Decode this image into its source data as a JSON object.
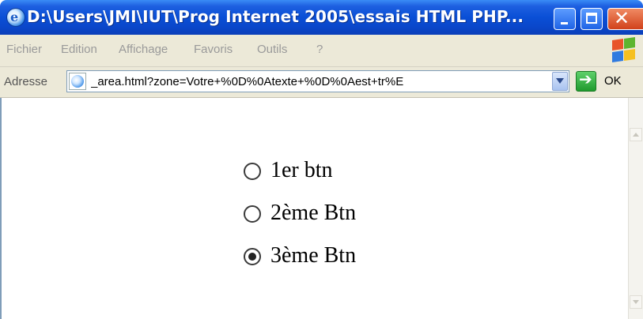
{
  "window": {
    "title": "D:\\Users\\JMI\\IUT\\Prog Internet 2005\\essais HTML PHP..."
  },
  "menu": {
    "items": [
      {
        "label": "Fichier"
      },
      {
        "label": "Edition"
      },
      {
        "label": "Affichage"
      },
      {
        "label": "Favoris"
      },
      {
        "label": "Outils"
      },
      {
        "label": "?"
      }
    ]
  },
  "address": {
    "label": "Adresse",
    "value": "_area.html?zone=Votre+%0D%0Atexte+%0D%0Aest+tr%E",
    "go_label": "OK"
  },
  "form": {
    "radios": [
      {
        "label": "1er btn",
        "checked": false
      },
      {
        "label": "2ème Btn",
        "checked": false
      },
      {
        "label": "3ème Btn",
        "checked": true
      }
    ]
  },
  "colors": {
    "titlebar": "#0a4fd6",
    "chrome": "#ece9d8",
    "close": "#d1421b"
  }
}
